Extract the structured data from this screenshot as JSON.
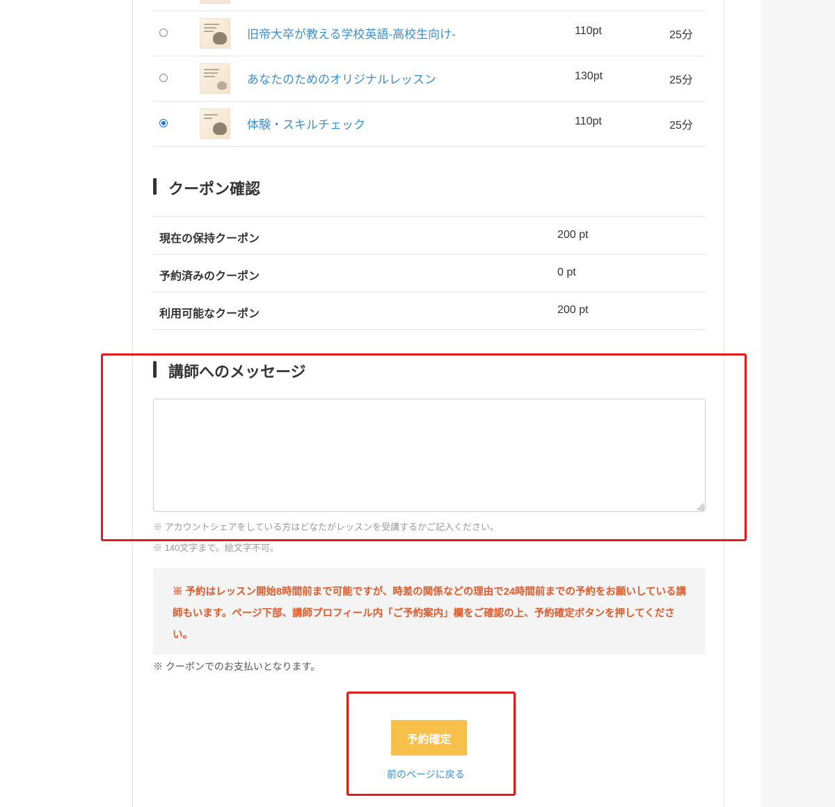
{
  "lessons": [
    {
      "title": "旧帝大卒が教える学校英語-高校生向け-",
      "points": "110pt",
      "duration": "25分",
      "selected": false
    },
    {
      "title": "あなたのためのオリジナルレッスン",
      "points": "130pt",
      "duration": "25分",
      "selected": false
    },
    {
      "title": "体験・スキルチェック",
      "points": "110pt",
      "duration": "25分",
      "selected": true
    }
  ],
  "coupon": {
    "heading": "クーポン確認",
    "rows": [
      {
        "label": "現在の保持クーポン",
        "value": "200 pt"
      },
      {
        "label": "予約済みのクーポン",
        "value": "0 pt"
      },
      {
        "label": "利用可能なクーポン",
        "value": "200 pt"
      }
    ]
  },
  "message": {
    "heading": "講師へのメッセージ",
    "value": "",
    "note1": "※ アカウントシェアをしている方はどなたがレッスンを受講するかご記入ください。",
    "note2": "※ 140文字まで。絵文字不可。"
  },
  "warning": {
    "text": "※ 予約はレッスン開始8時間前まで可能ですが、時差の関係などの理由で24時間前までの予約をお願いしている講師もいます。ページ下部、講師プロフィール内「ご予約案内」欄をご確認の上、予約確定ボタンを押してください。"
  },
  "payment_note": "※ クーポンでのお支払いとなります。",
  "actions": {
    "confirm_label": "予約確定",
    "back_label": "前のページに戻る"
  },
  "colors": {
    "link": "#3a8fd6",
    "button": "#f6c04a",
    "warning_text": "#e05a2a",
    "highlight": "#e61919"
  },
  "icons": {
    "radio": "radio-button-icon",
    "resize": "resize-grip-icon"
  }
}
